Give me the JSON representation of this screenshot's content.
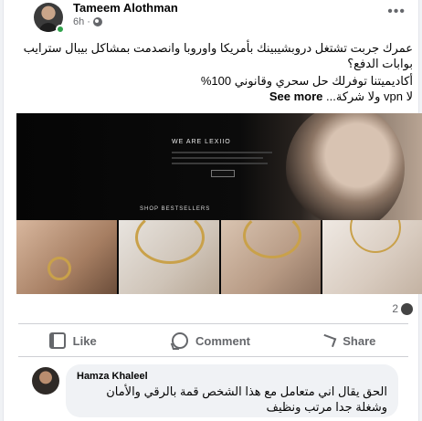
{
  "post": {
    "author": "Tameem Alothman",
    "time": "6h",
    "more_icon": "more-horizontal-icon",
    "text_line1": "عمرك جربت تشتغل دروبشيبينك بأمريكا واوروبا وانصدمت بمشاكل بيبال سترايب بوابات الدفع؟",
    "text_line2": "أكاديميتنا توفرلك حل سحري وقانوني 100%",
    "text_line3_main": "لا vpn ولا شركة...",
    "see_more": "See more"
  },
  "media": {
    "hero_title": "WE ARE LEXIIO",
    "bestsellers": "SHOP BESTSELLERS"
  },
  "stats": {
    "comments_count": "2"
  },
  "actions": [
    {
      "label": "Like",
      "icon": "like-icon"
    },
    {
      "label": "Comment",
      "icon": "comment-icon"
    },
    {
      "label": "Share",
      "icon": "share-icon"
    }
  ],
  "comment": {
    "author": "Hamza Khaleel",
    "text": "الحق يقال اني متعامل مع هذا الشخص قمة بالرقي والأمان وشغلة جدا مرتب ونظيف"
  },
  "colors": {
    "online": "#31a24c",
    "muted": "#65676b",
    "bubble": "#f0f2f5"
  }
}
